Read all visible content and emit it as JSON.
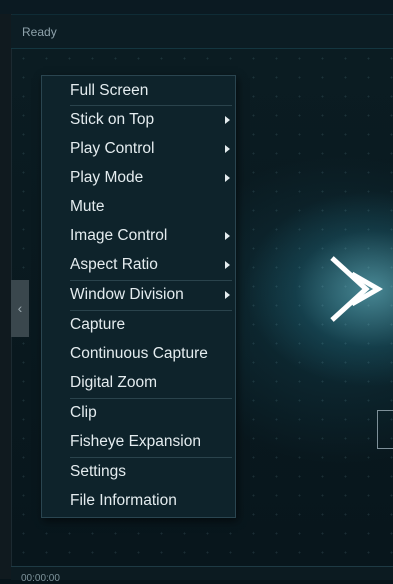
{
  "status": {
    "text": "Ready"
  },
  "playback": {
    "time": "00:00:00"
  },
  "context_menu": {
    "items": [
      {
        "label": "Full Screen",
        "submenu": false
      },
      {
        "label": "Stick on Top",
        "submenu": true
      },
      {
        "label": "Play Control",
        "submenu": true
      },
      {
        "label": "Play Mode",
        "submenu": true
      },
      {
        "label": "Mute",
        "submenu": false
      },
      {
        "label": "Image Control",
        "submenu": true
      },
      {
        "label": "Aspect Ratio",
        "submenu": true
      },
      {
        "label": "Window Division",
        "submenu": true
      },
      {
        "label": "Capture",
        "submenu": false
      },
      {
        "label": "Continuous Capture",
        "submenu": false
      },
      {
        "label": "Digital Zoom",
        "submenu": false
      },
      {
        "label": "Clip",
        "submenu": false
      },
      {
        "label": "Fisheye Expansion",
        "submenu": false
      },
      {
        "label": "Settings",
        "submenu": false
      },
      {
        "label": "File Information",
        "submenu": false
      }
    ]
  },
  "icons": {
    "prev": "chevron-left-icon",
    "logo": "double-chevron-right-logo",
    "submenu": "caret-right-icon"
  },
  "colors": {
    "background": "#07141a",
    "menu_bg": "#0e232b",
    "menu_text": "#e4ecef",
    "accent": "#7fd3e0"
  }
}
